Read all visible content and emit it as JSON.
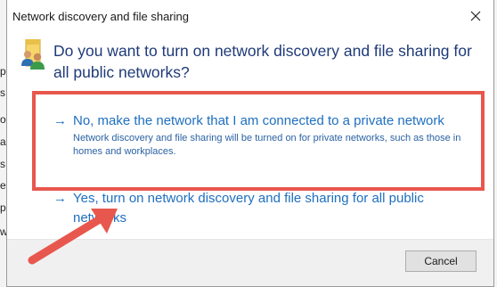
{
  "background_letters": [
    "p",
    "s",
    "o",
    "a",
    "s",
    "e",
    "p",
    "w"
  ],
  "dialog": {
    "title": "Network discovery and file sharing",
    "icon": "network-users-icon",
    "question": "Do you want to turn on network discovery and file sharing for all public networks?",
    "options": [
      {
        "arrow": "→",
        "label": "No, make the network that I am connected to a private network",
        "description": "Network discovery and file sharing will be turned on for private networks, such as those in homes and workplaces."
      },
      {
        "arrow": "→",
        "label": "Yes, turn on network discovery and file sharing for all public networks"
      }
    ],
    "cancel_label": "Cancel"
  },
  "colors": {
    "highlight": "#e8574d",
    "link": "#1f6fbf",
    "question": "#1f3a78"
  }
}
